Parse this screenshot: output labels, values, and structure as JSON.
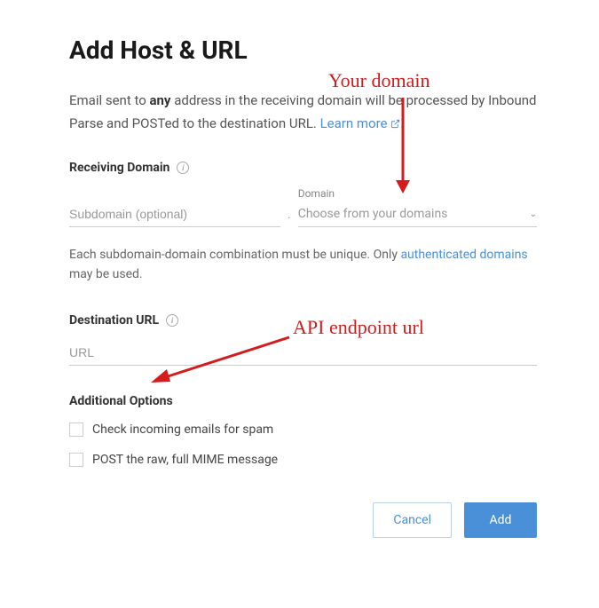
{
  "title": "Add Host & URL",
  "intro": {
    "pre": "Email sent to ",
    "bold": "any",
    "post": " address in the receiving domain will be processed by Inbound Parse and POSTed to the destination URL. ",
    "learn_more": "Learn more",
    "period": "."
  },
  "receiving": {
    "label": "Receiving Domain",
    "subdomain_placeholder": "Subdomain (optional)",
    "domain_label": "Domain",
    "domain_placeholder": "Choose from your domains"
  },
  "helper": {
    "pre": "Each subdomain-domain combination must be unique. Only ",
    "link": "authenticated domains",
    "post": " may be used."
  },
  "destination": {
    "label": "Destination URL",
    "url_placeholder": "URL"
  },
  "options": {
    "label": "Additional Options",
    "spam": "Check incoming emails for spam",
    "raw": "POST the raw, full MIME message"
  },
  "buttons": {
    "cancel": "Cancel",
    "add": "Add"
  },
  "annotations": {
    "domain": "Your domain",
    "api": "API endpoint url"
  }
}
